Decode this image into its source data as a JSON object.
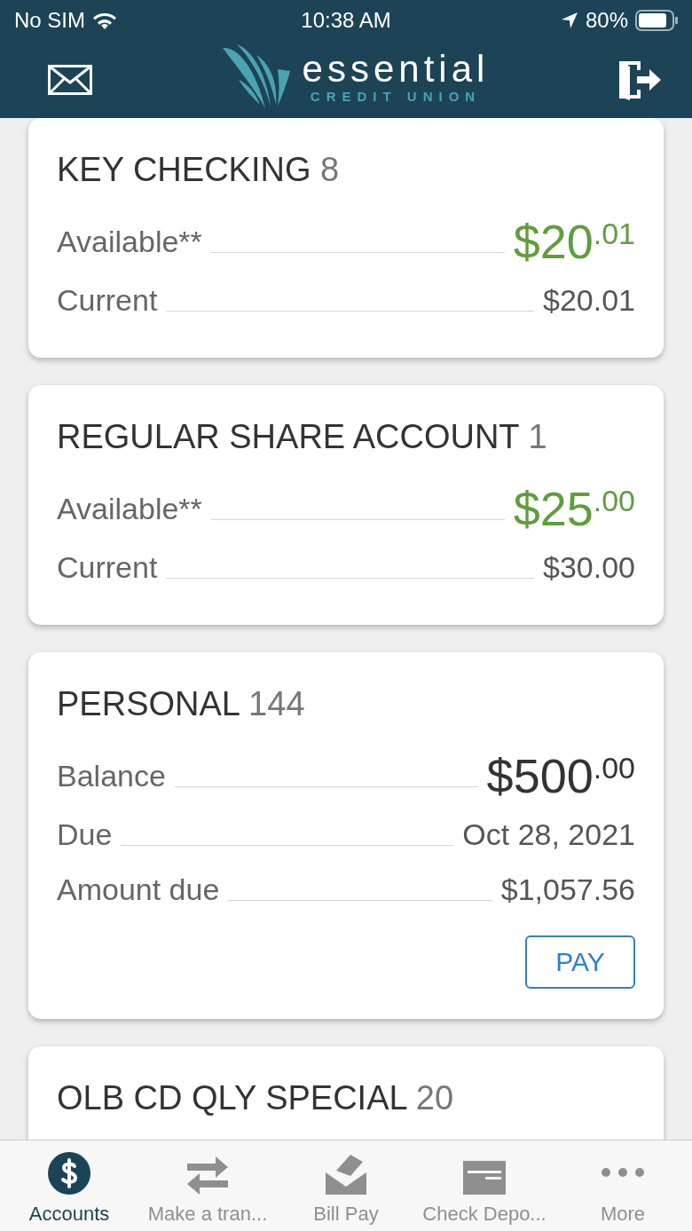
{
  "status_bar": {
    "carrier": "No SIM",
    "time": "10:38 AM",
    "battery": "80%"
  },
  "header": {
    "brand": "essential",
    "subtitle": "CREDIT UNION"
  },
  "accounts": [
    {
      "name": "KEY CHECKING",
      "number": "8",
      "rows": [
        {
          "kind": "big",
          "label": "Available**",
          "value": "$20$^{.01}$",
          "color": "#5e9e3c"
        },
        {
          "kind": "plain",
          "label": "Current",
          "value": "$20.01"
        }
      ]
    },
    {
      "name": "REGULAR SHARE ACCOUNT",
      "number": "1",
      "rows": [
        {
          "kind": "big",
          "label": "Available**",
          "value": "$25$^{.00}$",
          "color": "#5e9e3c"
        },
        {
          "kind": "plain",
          "label": "Current",
          "value": "$30.00"
        }
      ]
    },
    {
      "name": "PERSONAL",
      "number": "144",
      "rows": [
        {
          "kind": "big",
          "label": "Balance",
          "value": "$500$^{.00}$",
          "color": "#333333"
        },
        {
          "kind": "plain",
          "label": "Due",
          "value": "Oct 28, 2021"
        },
        {
          "kind": "plain",
          "label": "Amount due",
          "value": "$1,057.56"
        }
      ],
      "action": "PAY"
    },
    {
      "name": "OLB CD QLY SPECIAL",
      "number": "20"
    }
  ],
  "tabs": [
    {
      "label": "Accounts",
      "kind": "dollar",
      "selected": true
    },
    {
      "label": "Make a tran...",
      "kind": "transfer",
      "selected": false
    },
    {
      "label": "Bill Pay",
      "kind": "billpay",
      "selected": false
    },
    {
      "label": "Check Depo...",
      "kind": "check",
      "selected": false
    },
    {
      "label": "More",
      "kind": "more",
      "selected": false
    }
  ]
}
